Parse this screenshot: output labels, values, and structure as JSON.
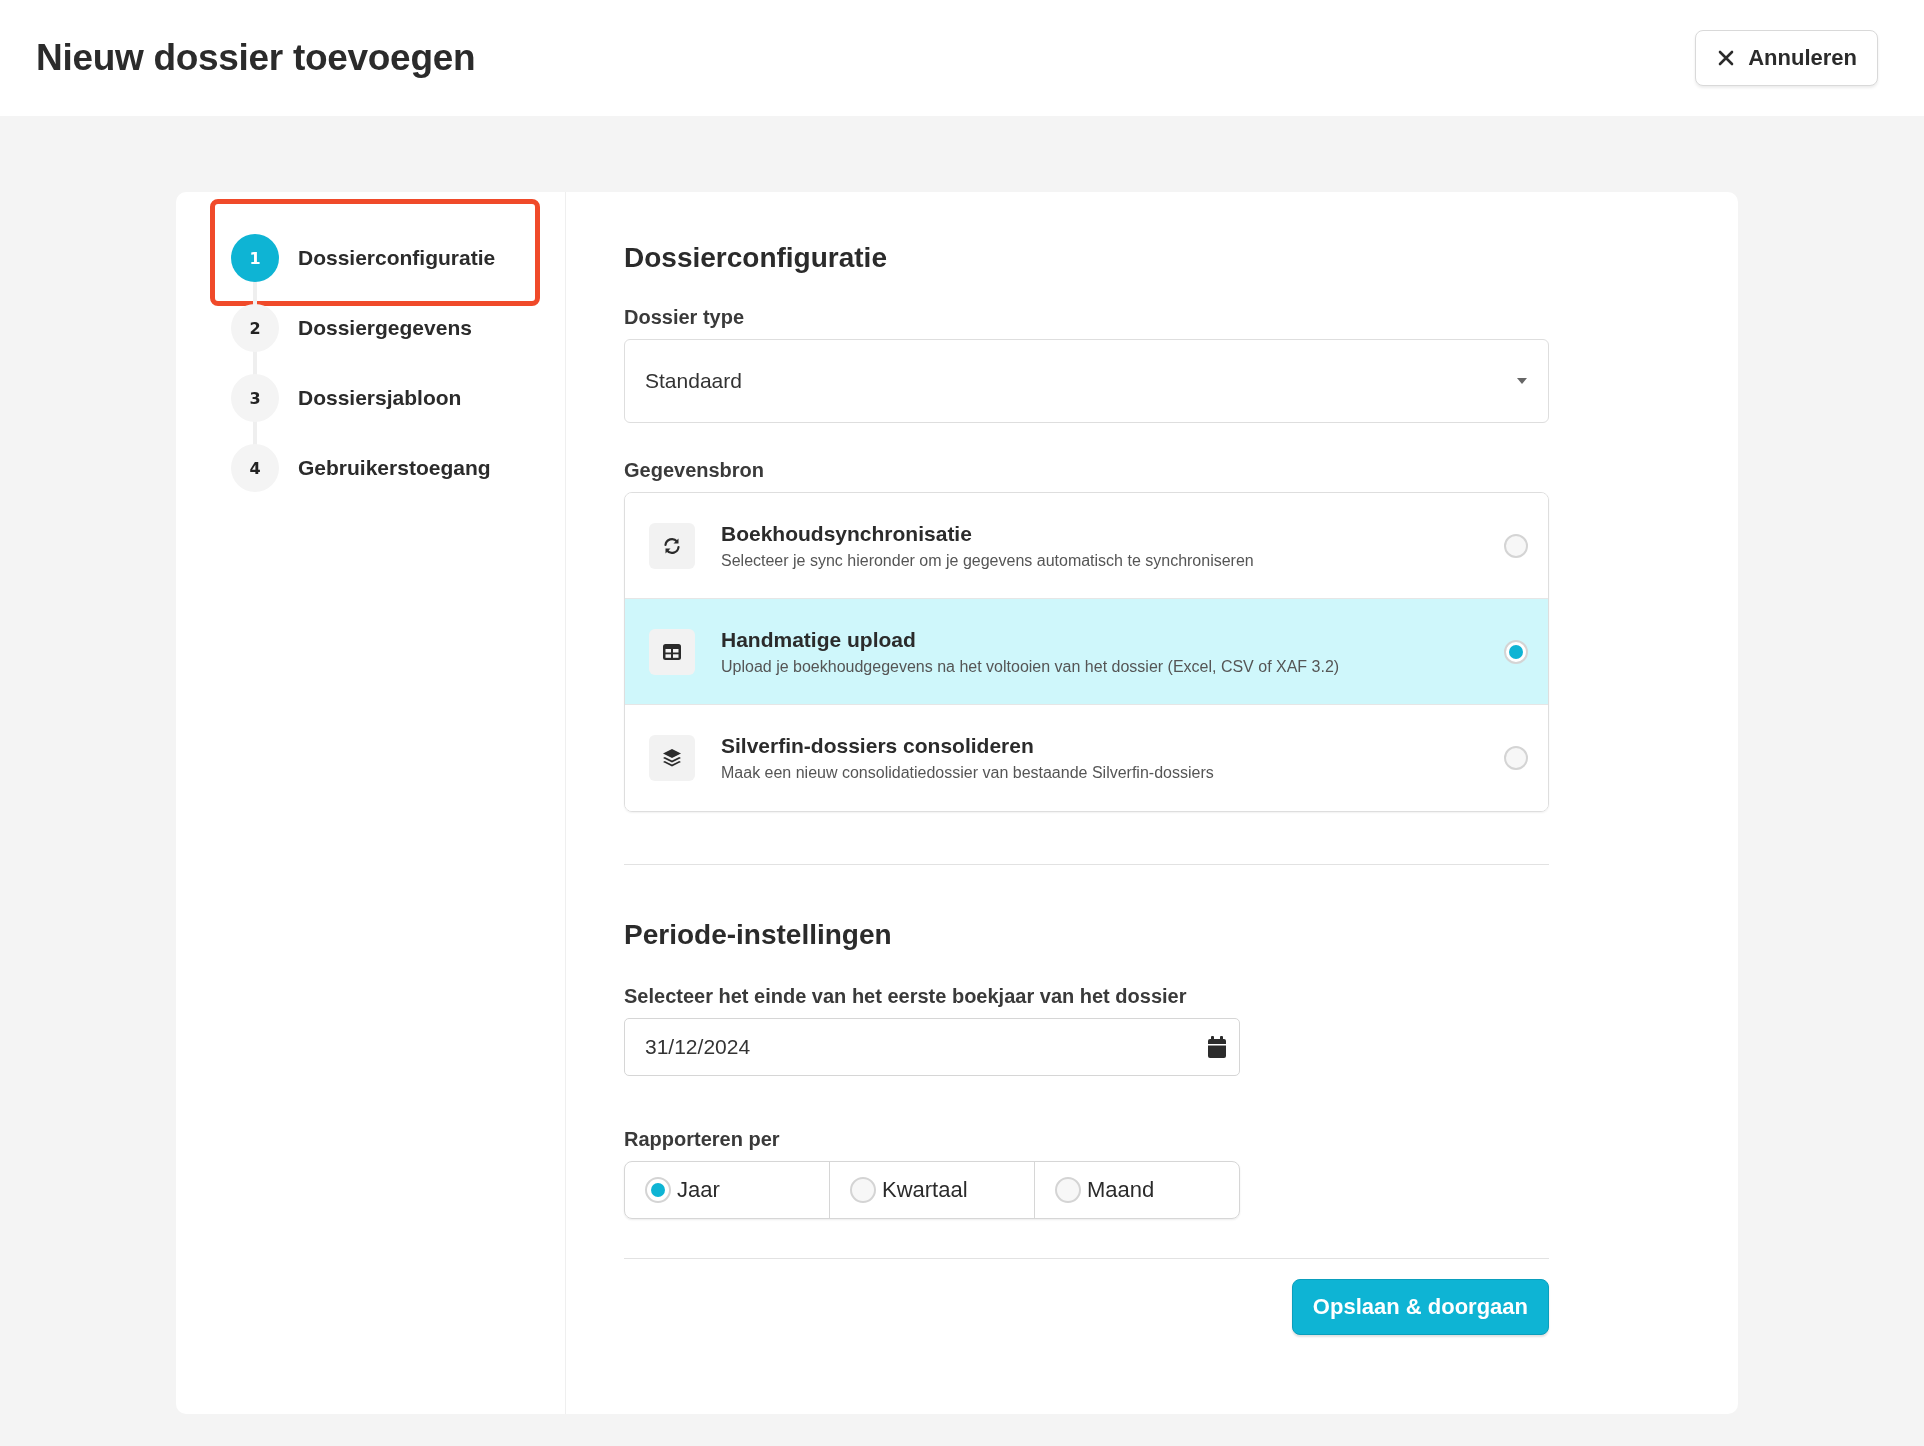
{
  "header": {
    "title": "Nieuw dossier toevoegen",
    "cancel_button": "Annuleren"
  },
  "steps": [
    {
      "number": "1",
      "label": "Dossierconfiguratie",
      "selected": true,
      "highlighted": true
    },
    {
      "number": "2",
      "label": "Dossiergegevens",
      "selected": false,
      "highlighted": false
    },
    {
      "number": "3",
      "label": "Dossiersjabloon",
      "selected": false,
      "highlighted": false
    },
    {
      "number": "4",
      "label": "Gebruikerstoegang",
      "selected": false,
      "highlighted": false
    }
  ],
  "dossier_configuration": {
    "heading": "Dossierconfiguratie",
    "dossier_type": {
      "label": "Dossier type",
      "value": "Standaard"
    },
    "data_source": {
      "label": "Gegevensbron",
      "options": [
        {
          "kind": "sync",
          "title": "Boekhoudsynchronisatie",
          "description": "Selecteer je sync hieronder om je gegevens automatisch te synchroniseren",
          "selected": false
        },
        {
          "kind": "upload",
          "title": "Handmatige upload",
          "description": "Upload je boekhoudgegevens na het voltooien van het dossier (Excel, CSV of XAF 3.2)",
          "selected": true
        },
        {
          "kind": "consolidate",
          "title": "Silverfin-dossiers consolideren",
          "description": "Maak een nieuw consolidatiedossier van bestaande Silverfin-dossiers",
          "selected": false
        }
      ]
    }
  },
  "period_settings": {
    "heading": "Periode-instellingen",
    "fiscal_year_end": {
      "label": "Selecteer het einde van het eerste boekjaar van het dossier",
      "value": "31/12/2024"
    },
    "report_per": {
      "label": "Rapporteren per",
      "options": [
        {
          "label": "Jaar",
          "selected": true
        },
        {
          "label": "Kwartaal",
          "selected": false
        },
        {
          "label": "Maand",
          "selected": false
        }
      ]
    }
  },
  "save_button": "Opslaan & doorgaan"
}
